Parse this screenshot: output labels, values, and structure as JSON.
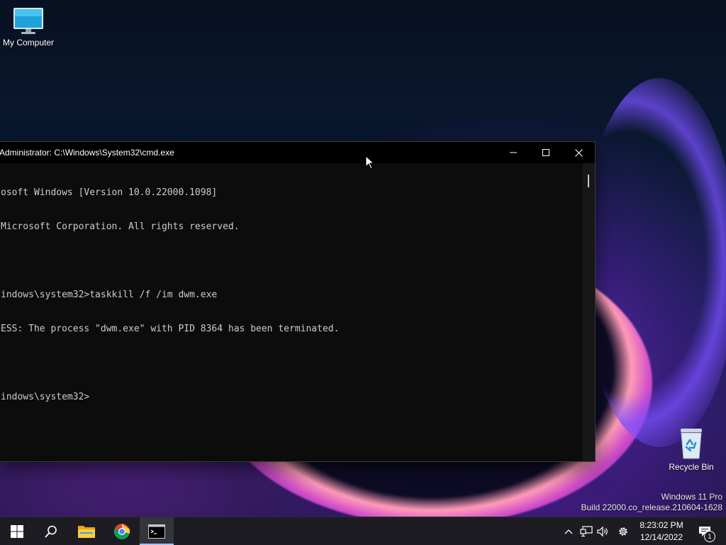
{
  "desktop": {
    "icons": [
      {
        "label": "My Computer",
        "icon": "monitor-icon"
      },
      {
        "label": "Recycle Bin",
        "icon": "recycle-bin-icon"
      }
    ],
    "watermark": {
      "line1": "Windows 11 Pro",
      "line2": "Build 22000.co_release.210604-1628"
    }
  },
  "cmd": {
    "title": "Administrator: C:\\Windows\\System32\\cmd.exe",
    "lines": [
      "osoft Windows [Version 10.0.22000.1098]",
      "Microsoft Corporation. All rights reserved.",
      "",
      "indows\\system32>taskkill /f /im dwm.exe",
      "ESS: The process \"dwm.exe\" with PID 8364 has been terminated.",
      "",
      "indows\\system32>"
    ]
  },
  "taskbar": {
    "apps": [
      "start-icon",
      "search-icon",
      "file-explorer-icon",
      "chrome-icon",
      "cmd-icon"
    ],
    "active_app": "cmd-icon",
    "clock": {
      "time": "8:23:02 PM",
      "date": "12/14/2022"
    },
    "notification_count": "1"
  },
  "colors": {
    "taskbar_bg": "#1c1c22",
    "console_bg": "#0c0c0c",
    "console_text": "#cccccc",
    "active_indicator": "#9ec2ff"
  }
}
